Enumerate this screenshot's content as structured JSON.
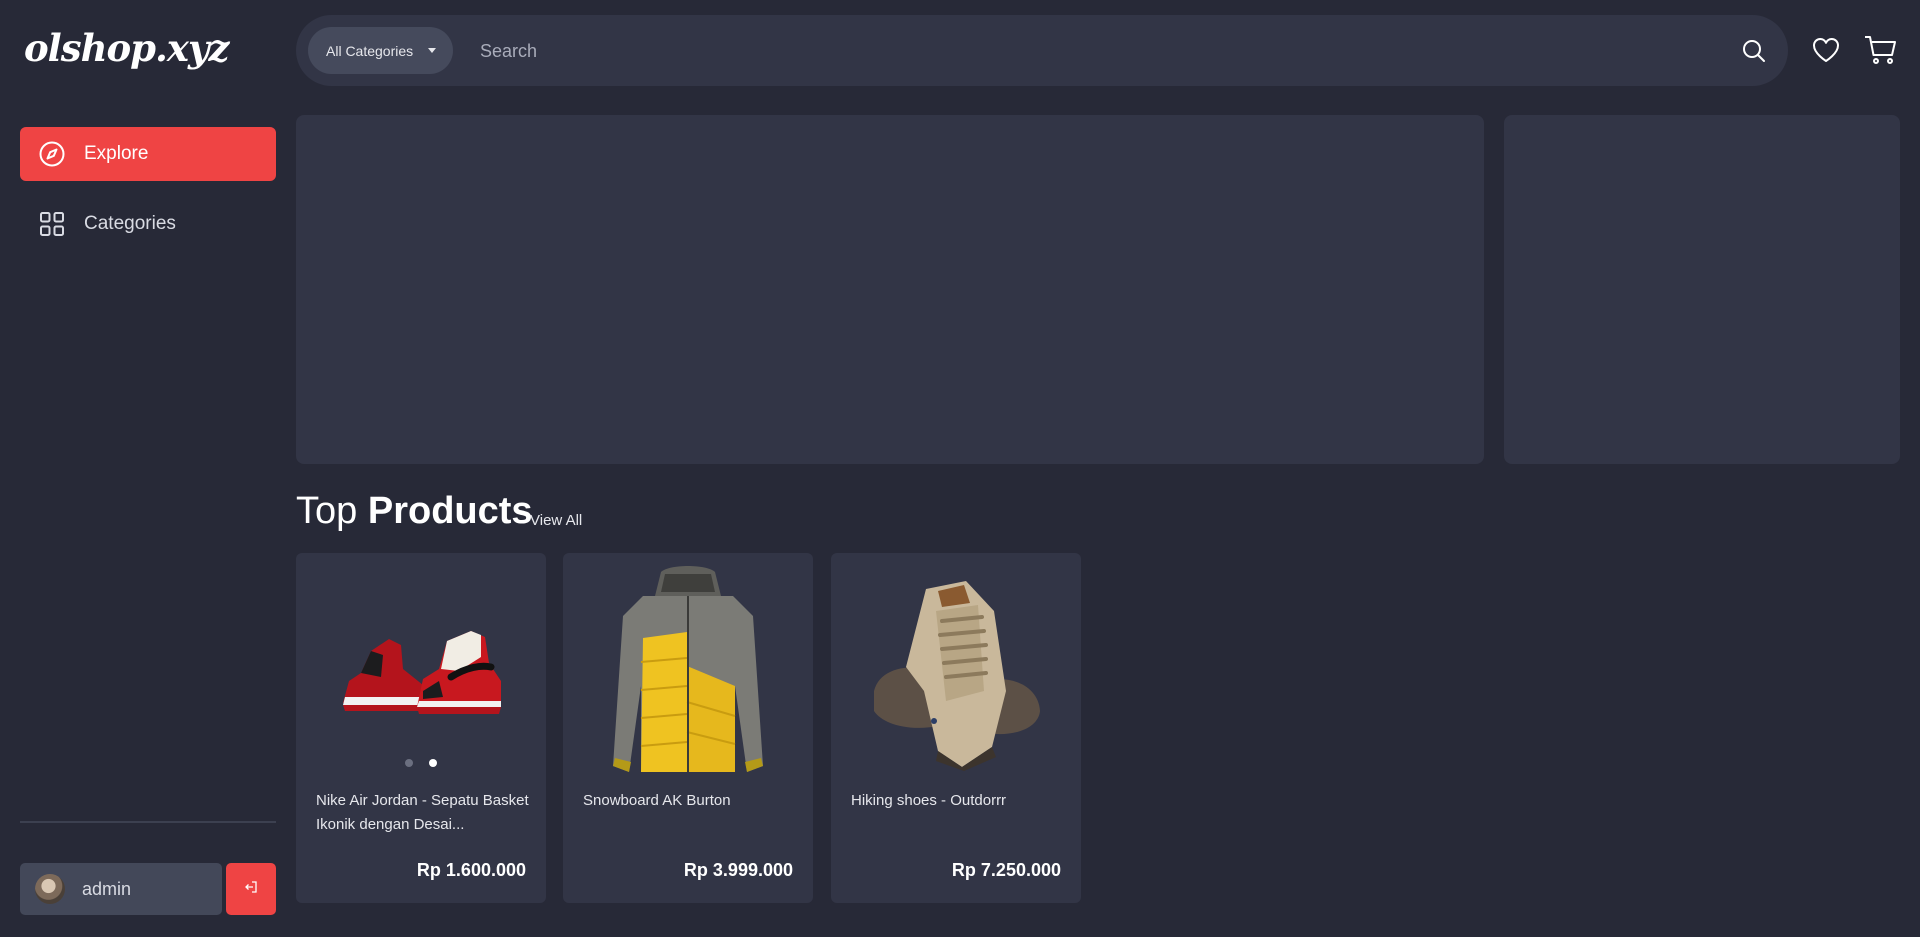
{
  "app": {
    "logo": "olshop.xyz"
  },
  "sidebar": {
    "items": [
      {
        "label": "Explore",
        "icon": "compass-icon",
        "active": true
      },
      {
        "label": "Categories",
        "icon": "grid-icon",
        "active": false
      }
    ],
    "user": {
      "name": "admin"
    }
  },
  "header": {
    "category_select": "All Categories",
    "search_placeholder": "Search"
  },
  "section": {
    "title_light": "Top",
    "title_bold": "Products",
    "view_all": "View All"
  },
  "products": [
    {
      "name": "Nike Air Jordan - Sepatu Basket Ikonik dengan Desain Klasik",
      "name_display": "Nike Air Jordan - Sepatu Basket Ikonik dengan Desai...",
      "price": "Rp 1.600.000"
    },
    {
      "name": "Snowboard AK Burton",
      "name_display": "Snowboard AK Burton",
      "price": "Rp 3.999.000"
    },
    {
      "name": "Hiking shoes - Outdorrr",
      "name_display": "Hiking shoes - Outdorrr",
      "price": "Rp 7.250.000"
    }
  ],
  "colors": {
    "accent": "#ef4444",
    "bg": "#272937",
    "panel": "#323546"
  }
}
